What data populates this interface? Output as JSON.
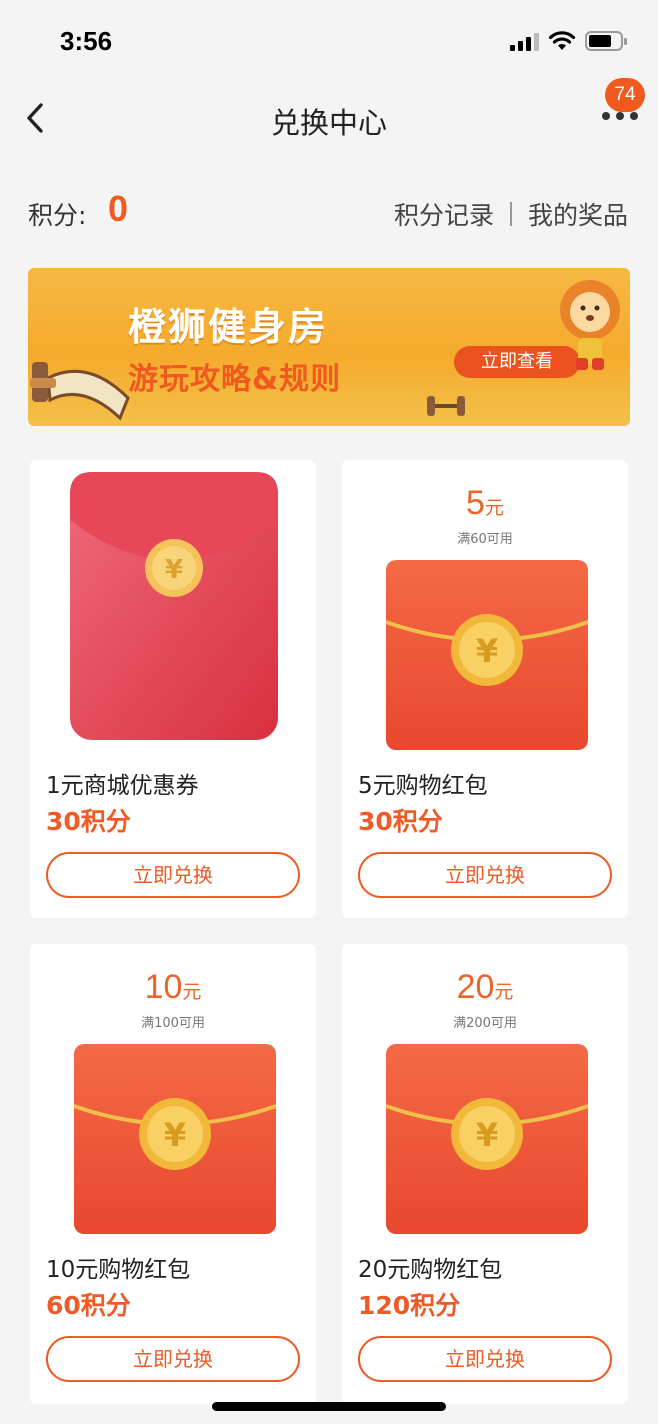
{
  "status_bar": {
    "time": "3:56"
  },
  "nav": {
    "title": "兑换中心",
    "badge": "74"
  },
  "points": {
    "label": "积分:",
    "value": "0",
    "record_link": "积分记录",
    "prizes_link": "我的奖品"
  },
  "banner": {
    "title": "橙狮健身房",
    "subtitle": "游玩攻略&规则",
    "button": "立即查看"
  },
  "items": [
    {
      "name": "1元商城优惠券",
      "price": "30积分",
      "button": "立即兑换",
      "amount": "",
      "unit": "",
      "condition": ""
    },
    {
      "name": "5元购物红包",
      "price": "30积分",
      "button": "立即兑换",
      "amount": "5",
      "unit": "元",
      "condition": "满60可用"
    },
    {
      "name": "10元购物红包",
      "price": "60积分",
      "button": "立即兑换",
      "amount": "10",
      "unit": "元",
      "condition": "满100可用"
    },
    {
      "name": "20元购物红包",
      "price": "120积分",
      "button": "立即兑换",
      "amount": "20",
      "unit": "元",
      "condition": "满200可用"
    }
  ],
  "colors": {
    "accent": "#ee5b26",
    "badge": "#f05a1e",
    "banner": "#f5aa2c"
  }
}
